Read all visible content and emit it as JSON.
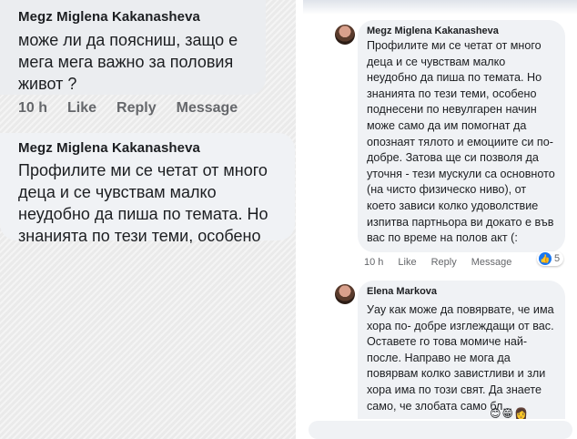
{
  "left": {
    "comment1": {
      "author": "Megz Miglena Kakanasheva",
      "text": "може ли да поясниш, защо е мега мега важно за половия живот ?",
      "time": "10 h",
      "like": "Like",
      "reply": "Reply",
      "message": "Message"
    },
    "comment2": {
      "author": "Megz Miglena Kakanasheva",
      "text": "Профилите ми се четат от много деца и се чувствам малко неудобно да пиша по темата. Но знанията по тези теми, особено"
    }
  },
  "right": {
    "comment1": {
      "author": "Megz Miglena Kakanasheva",
      "text": "Профилите ми се четат от много деца и се чувствам малко неудобно да пиша по темата. Но знанията по тези теми, особено поднесени по невулгарен начин може само да им помогнат да опознаят тялото и емоциите си по-добре. Затова ще си позволя да уточня - тези мускули са основното (на чисто физическо ниво), от което зависи колко удоволствие изпитва партньора ви докато е във вас по време на полов акт (:",
      "time": "10 h",
      "like": "Like",
      "reply": "Reply",
      "message": "Message",
      "reaction_count": "5",
      "reaction_icon": "thumbs-up-icon"
    },
    "comment2": {
      "author": "Elena Markova",
      "text": "Уау как може да повярвате, че има хора по- добре изглеждащи от вас. Оставете го това момиче най- после. Направо не мога да повярвам колко завистливи и зли хора има по този свят. Да знаете само, че злобата само бл..."
    }
  },
  "colors": {
    "bubble": "#f0f2f5",
    "meta_text": "#65676b",
    "like_blue": "#1877f2"
  }
}
